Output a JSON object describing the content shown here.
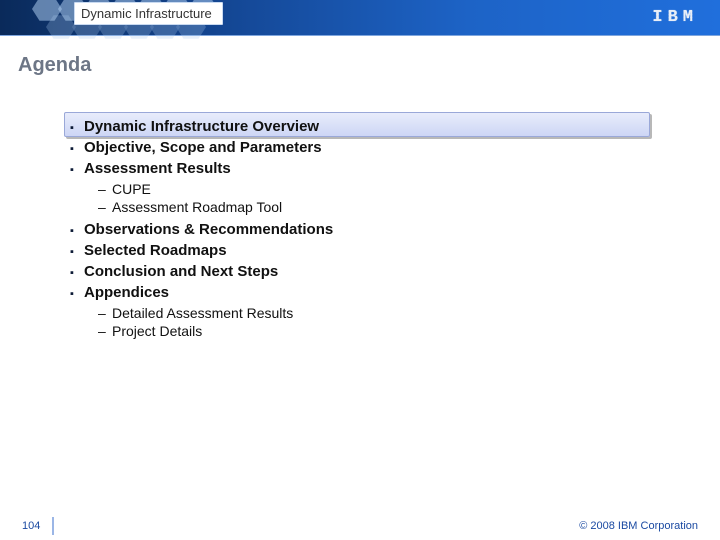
{
  "header": {
    "title": "Dynamic Infrastructure",
    "logo_text": "IBM"
  },
  "slide_title": "Agenda",
  "agenda": {
    "highlighted_index": 0,
    "items": [
      {
        "label": "Dynamic Infrastructure Overview"
      },
      {
        "label": "Objective, Scope and Parameters"
      },
      {
        "label": "Assessment Results",
        "sub": [
          {
            "label": "CUPE"
          },
          {
            "label": "Assessment Roadmap Tool"
          }
        ]
      },
      {
        "label": "Observations & Recommendations"
      },
      {
        "label": "Selected Roadmaps"
      },
      {
        "label": "Conclusion and Next Steps"
      },
      {
        "label": "Appendices",
        "sub": [
          {
            "label": "Detailed Assessment Results"
          },
          {
            "label": "Project Details"
          }
        ]
      }
    ]
  },
  "footer": {
    "page_number": "104",
    "copyright": "© 2008 IBM Corporation"
  }
}
